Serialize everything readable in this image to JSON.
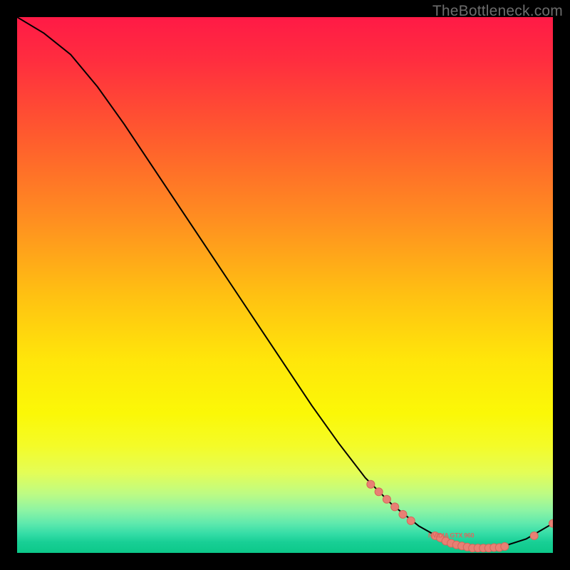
{
  "watermark": "TheBottleneck.com",
  "point_label": "NVIDIA GTX 960",
  "colors": {
    "curve": "#000000",
    "point_fill": "#e88074",
    "point_stroke": "#d7655a"
  },
  "chart_data": {
    "type": "line",
    "title": "",
    "xlabel": "",
    "ylabel": "",
    "xlim": [
      0,
      100
    ],
    "ylim": [
      0,
      100
    ],
    "grid": false,
    "curve": [
      {
        "x": 0,
        "y": 100
      },
      {
        "x": 5,
        "y": 97
      },
      {
        "x": 10,
        "y": 93
      },
      {
        "x": 15,
        "y": 87
      },
      {
        "x": 20,
        "y": 80
      },
      {
        "x": 25,
        "y": 72.5
      },
      {
        "x": 30,
        "y": 65
      },
      {
        "x": 35,
        "y": 57.5
      },
      {
        "x": 40,
        "y": 50
      },
      {
        "x": 45,
        "y": 42.5
      },
      {
        "x": 50,
        "y": 35
      },
      {
        "x": 55,
        "y": 27.5
      },
      {
        "x": 60,
        "y": 20.5
      },
      {
        "x": 65,
        "y": 14
      },
      {
        "x": 70,
        "y": 9
      },
      {
        "x": 75,
        "y": 5
      },
      {
        "x": 80,
        "y": 2.2
      },
      {
        "x": 85,
        "y": 0.9
      },
      {
        "x": 90,
        "y": 1.0
      },
      {
        "x": 95,
        "y": 2.6
      },
      {
        "x": 100,
        "y": 5.5
      }
    ],
    "points": [
      {
        "x": 66,
        "y": 12.8
      },
      {
        "x": 67.5,
        "y": 11.4
      },
      {
        "x": 69,
        "y": 10.0
      },
      {
        "x": 70.5,
        "y": 8.6
      },
      {
        "x": 72,
        "y": 7.2
      },
      {
        "x": 73.5,
        "y": 6.0
      },
      {
        "x": 78,
        "y": 3.2
      },
      {
        "x": 79,
        "y": 2.8
      },
      {
        "x": 80,
        "y": 2.2
      },
      {
        "x": 81,
        "y": 1.8
      },
      {
        "x": 82,
        "y": 1.5
      },
      {
        "x": 83,
        "y": 1.3
      },
      {
        "x": 84,
        "y": 1.1
      },
      {
        "x": 85,
        "y": 0.9
      },
      {
        "x": 86,
        "y": 0.9
      },
      {
        "x": 87,
        "y": 0.9
      },
      {
        "x": 88,
        "y": 0.9
      },
      {
        "x": 89,
        "y": 1.0
      },
      {
        "x": 90,
        "y": 1.0
      },
      {
        "x": 91,
        "y": 1.2
      },
      {
        "x": 96.5,
        "y": 3.2
      },
      {
        "x": 100,
        "y": 5.5
      }
    ],
    "point_label": {
      "x": 81,
      "y": 2.3
    }
  }
}
